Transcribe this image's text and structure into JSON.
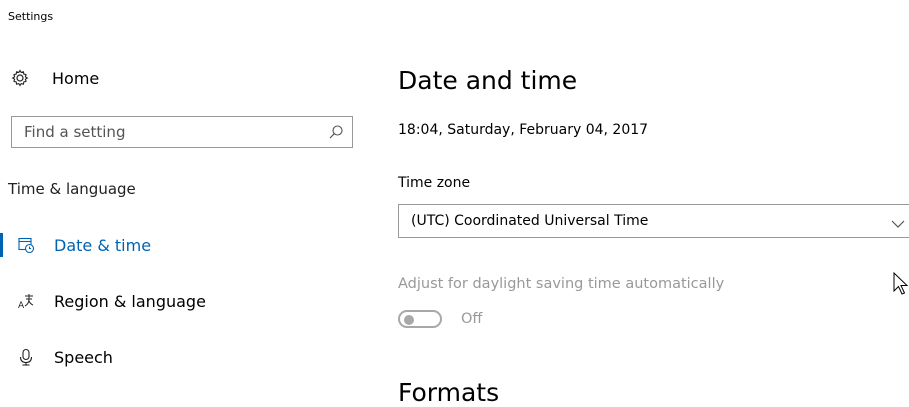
{
  "window": {
    "title": "Settings"
  },
  "sidebar": {
    "home": {
      "label": "Home",
      "icon": "gear-icon"
    },
    "search": {
      "placeholder": "Find a setting",
      "icon": "search-icon"
    },
    "section_label": "Time & language",
    "items": [
      {
        "label": "Date & time",
        "icon": "calendar-clock-icon",
        "active": true
      },
      {
        "label": "Region & language",
        "icon": "language-icon",
        "active": false
      },
      {
        "label": "Speech",
        "icon": "microphone-icon",
        "active": false
      }
    ]
  },
  "main": {
    "title": "Date and time",
    "current_datetime": "18:04, Saturday, February 04, 2017",
    "timezone": {
      "label": "Time zone",
      "value": "(UTC) Coordinated Universal Time"
    },
    "dst": {
      "label": "Adjust for daylight saving time automatically",
      "state": "Off"
    },
    "formats_heading": "Formats"
  },
  "colors": {
    "accent": "#0063b1",
    "disabled_text": "#999999",
    "border": "#999999"
  }
}
